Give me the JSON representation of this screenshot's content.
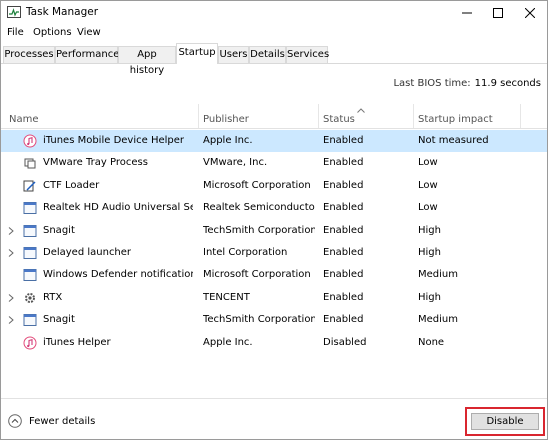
{
  "window": {
    "title": "Task Manager"
  },
  "menu": [
    "File",
    "Options",
    "View"
  ],
  "tabs": [
    "Processes",
    "Performance",
    "App history",
    "Startup",
    "Users",
    "Details",
    "Services"
  ],
  "active_tab": "Startup",
  "bios": {
    "label": "Last BIOS time:",
    "value": "11.9 seconds"
  },
  "columns": {
    "name": "Name",
    "publisher": "Publisher",
    "status": "Status",
    "impact": "Startup impact"
  },
  "rows": [
    {
      "name": "iTunes Mobile Device Helper",
      "publisher": "Apple Inc.",
      "status": "Enabled",
      "impact": "Not measured",
      "icon": "itunes-icon",
      "expandable": false,
      "selected": true
    },
    {
      "name": "VMware Tray Process",
      "publisher": "VMware, Inc.",
      "status": "Enabled",
      "impact": "Low",
      "icon": "vmware-icon",
      "expandable": false,
      "selected": false
    },
    {
      "name": "CTF Loader",
      "publisher": "Microsoft Corporation",
      "status": "Enabled",
      "impact": "Low",
      "icon": "ctf-icon",
      "expandable": false,
      "selected": false
    },
    {
      "name": "Realtek HD Audio Universal Service",
      "publisher": "Realtek Semiconductor",
      "status": "Enabled",
      "impact": "Low",
      "icon": "app-icon",
      "expandable": false,
      "selected": false
    },
    {
      "name": "Snagit",
      "publisher": "TechSmith Corporation",
      "status": "Enabled",
      "impact": "High",
      "icon": "app-icon",
      "expandable": true,
      "selected": false
    },
    {
      "name": "Delayed launcher",
      "publisher": "Intel Corporation",
      "status": "Enabled",
      "impact": "High",
      "icon": "app-icon",
      "expandable": true,
      "selected": false
    },
    {
      "name": "Windows Defender notification ic...",
      "publisher": "Microsoft Corporation",
      "status": "Enabled",
      "impact": "Medium",
      "icon": "app-icon",
      "expandable": false,
      "selected": false
    },
    {
      "name": "RTX",
      "publisher": "TENCENT",
      "status": "Enabled",
      "impact": "High",
      "icon": "gear-icon",
      "expandable": true,
      "selected": false
    },
    {
      "name": "Snagit",
      "publisher": "TechSmith Corporation",
      "status": "Enabled",
      "impact": "Medium",
      "icon": "app-icon",
      "expandable": true,
      "selected": false
    },
    {
      "name": "iTunes Helper",
      "publisher": "Apple Inc.",
      "status": "Disabled",
      "impact": "None",
      "icon": "itunes-icon",
      "expandable": false,
      "selected": false
    }
  ],
  "footer": {
    "fewer_details": "Fewer details",
    "disable": "Disable"
  },
  "colors": {
    "selection": "#cce8ff",
    "highlight": "#d9262f"
  }
}
